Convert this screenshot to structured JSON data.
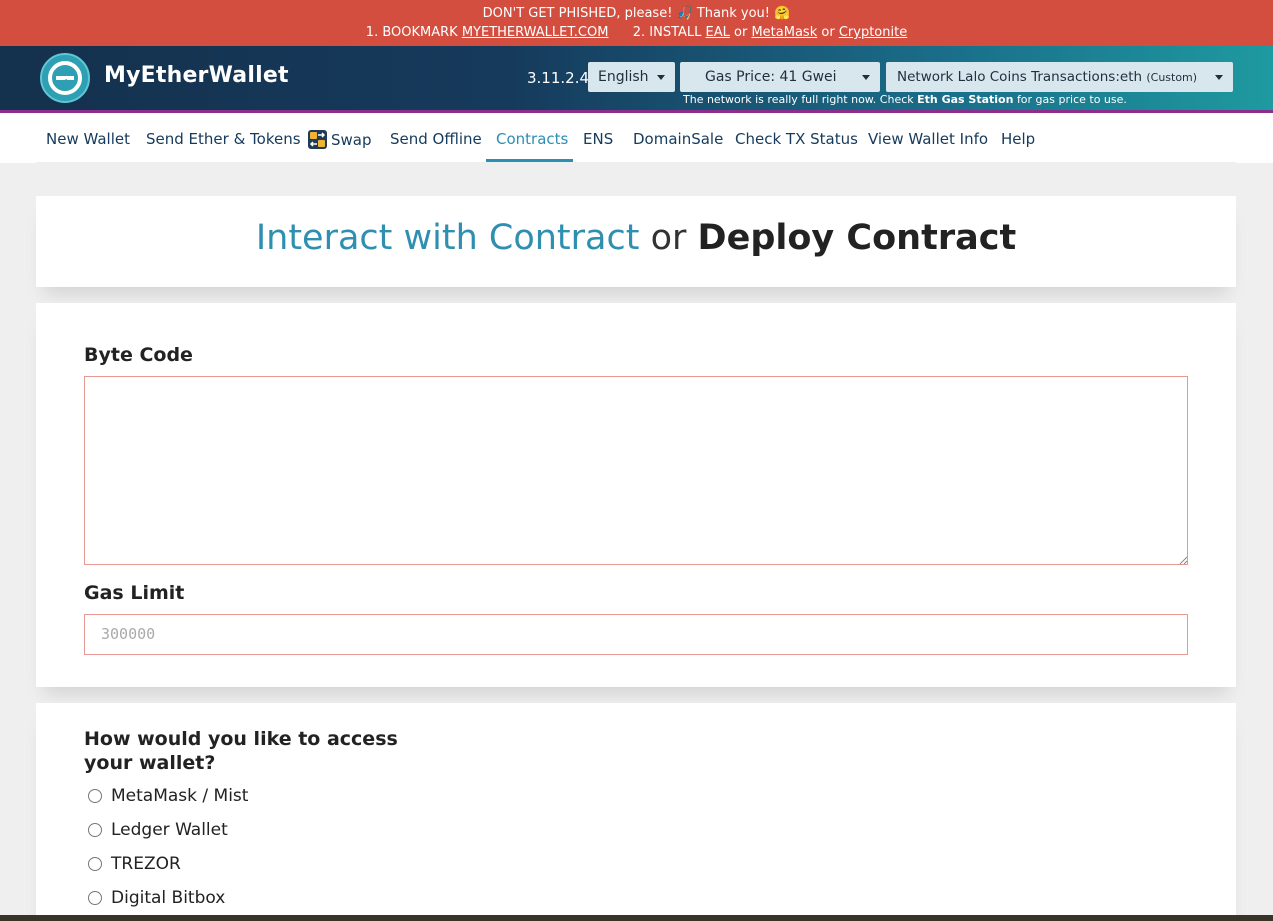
{
  "banner": {
    "line1": "DON'T GET PHISHED, please! 🎣 Thank you! 🤗",
    "step1_prefix": "1. BOOKMARK",
    "step1_link": "MYETHERWALLET.COM",
    "step2_prefix": "2. INSTALL",
    "link_eal": "EAL",
    "or1": "or",
    "link_metamask": "MetaMask",
    "or2": "or",
    "link_cryptonite": "Cryptonite"
  },
  "header": {
    "app_name": "MyEtherWallet",
    "version": "3.11.2.4",
    "language": "English",
    "gas_price": "Gas Price: 41 Gwei",
    "network": "Network Lalo Coins Transactions:eth",
    "network_suffix": "(Custom)",
    "gas_note_prefix": "The network is really full right now. Check",
    "gas_note_link": "Eth Gas Station",
    "gas_note_suffix": "for gas price to use."
  },
  "nav": {
    "items": [
      {
        "label": "New Wallet"
      },
      {
        "label": "Send Ether & Tokens"
      },
      {
        "label": "Swap"
      },
      {
        "label": "Send Offline"
      },
      {
        "label": "Contracts"
      },
      {
        "label": "ENS"
      },
      {
        "label": "DomainSale"
      },
      {
        "label": "Check TX Status"
      },
      {
        "label": "View Wallet Info"
      },
      {
        "label": "Help"
      }
    ],
    "active": "Contracts"
  },
  "title": {
    "interact": "Interact with Contract",
    "or": "or",
    "deploy": "Deploy Contract"
  },
  "form": {
    "bytecode_label": "Byte Code",
    "bytecode_value": "",
    "gaslimit_label": "Gas Limit",
    "gaslimit_placeholder": "300000"
  },
  "access": {
    "question": "How would you like to access your wallet?",
    "options": [
      {
        "label": "MetaMask / Mist"
      },
      {
        "label": "Ledger Wallet"
      },
      {
        "label": "TREZOR"
      },
      {
        "label": "Digital Bitbox"
      }
    ]
  },
  "colors": {
    "banner": "#d44e3f",
    "header_dark": "#14314d",
    "header_teal": "#1e9aa0",
    "accent": "#2b8fb3",
    "error_border": "#e79a94"
  }
}
